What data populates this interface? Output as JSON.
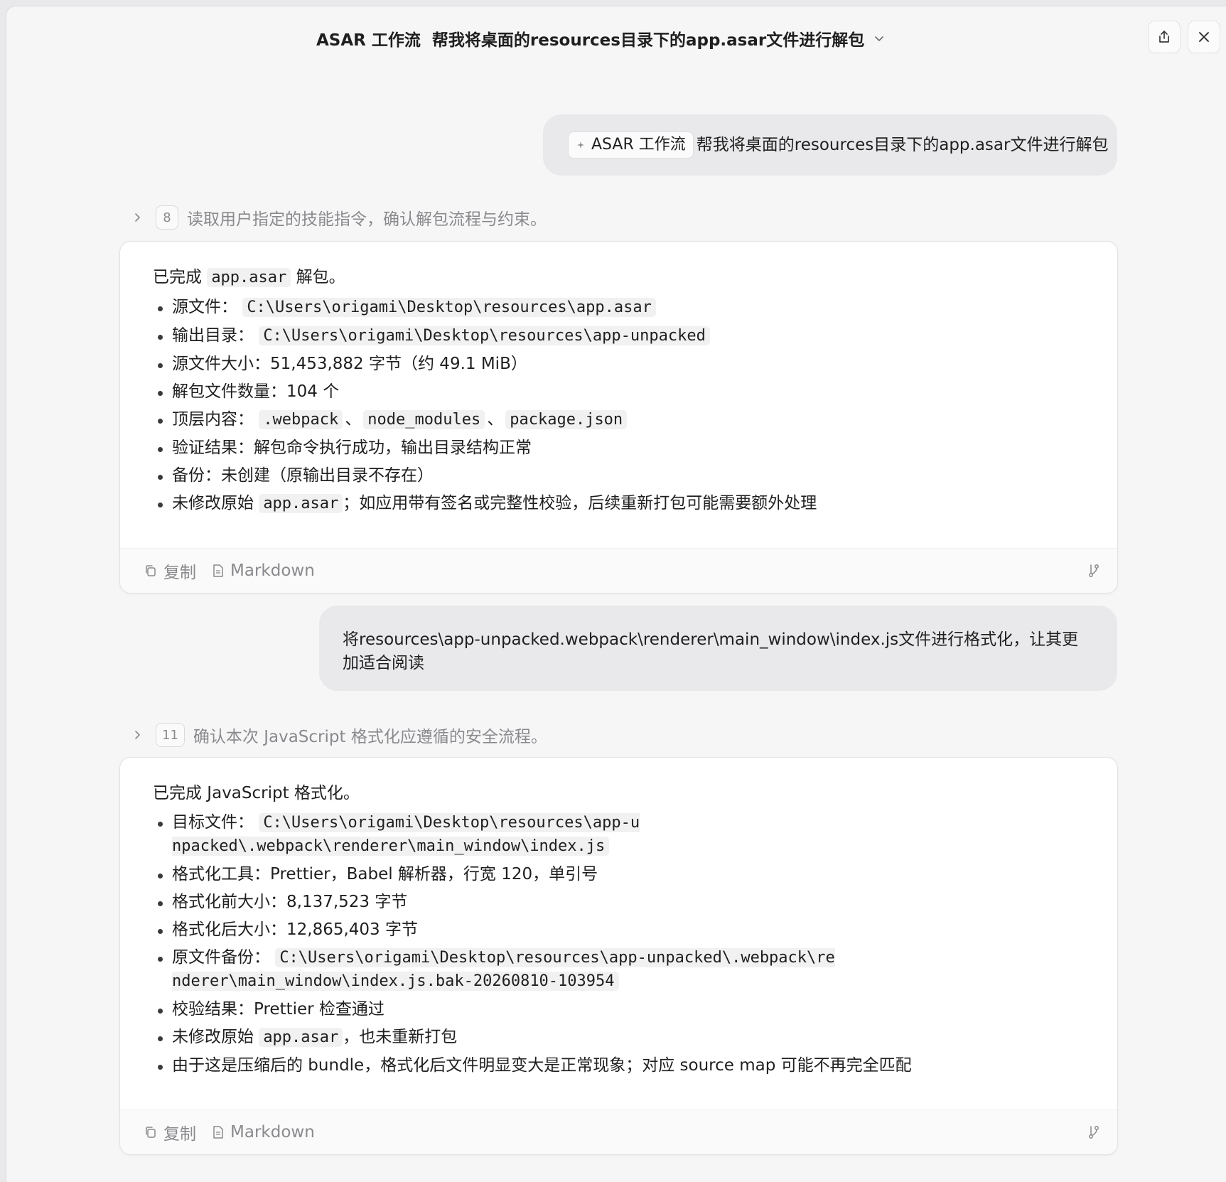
{
  "header": {
    "title": "ASAR 工作流  帮我将桌面的resources目录下的app.asar文件进行解包"
  },
  "messages": {
    "user1": {
      "chip_label": "ASAR 工作流",
      "text": "帮我将桌面的resources目录下的app.asar文件进行解包"
    },
    "step1": {
      "count": "8",
      "text": "读取用户指定的技能指令，确认解包流程与约束。"
    },
    "answer1": {
      "lead_prefix": "已完成",
      "lead_code": "app.asar",
      "lead_suffix": "解包。",
      "items": {
        "i0": {
          "label": "源文件：",
          "code": "C:\\Users\\origami\\Desktop\\resources\\app.asar"
        },
        "i1": {
          "label": "输出目录：",
          "code": "C:\\Users\\origami\\Desktop\\resources\\app-unpacked"
        },
        "i2": {
          "text": "源文件大小：51,453,882 字节（约 49.1 MiB）"
        },
        "i3": {
          "text": "解包文件数量：104 个"
        },
        "i4": {
          "label": "顶层内容：",
          "code_a": ".webpack",
          "sep_a": "、",
          "code_b": "node_modules",
          "sep_b": "、",
          "code_c": "package.json"
        },
        "i5": {
          "text": "验证结果：解包命令执行成功，输出目录结构正常"
        },
        "i6": {
          "text": "备份：未创建（原输出目录不存在）"
        },
        "i7": {
          "label": "未修改原始",
          "code": "app.asar",
          "suffix": "；如应用带有签名或完整性校验，后续重新打包可能需要额外处理"
        }
      },
      "copy_label": "复制",
      "markdown_label": "Markdown"
    },
    "user2": {
      "text": "将resources\\app-unpacked.webpack\\renderer\\main_window\\index.js文件进行格式化，让其更加适合阅读"
    },
    "step2": {
      "count": "11",
      "text": "确认本次 JavaScript 格式化应遵循的安全流程。"
    },
    "answer2": {
      "lead": "已完成 JavaScript 格式化。",
      "items": {
        "i0": {
          "label": "目标文件：",
          "code": "C:\\Users\\origami\\Desktop\\resources\\app-unpacked\\.webpack\\renderer\\main_window\\index.js"
        },
        "i1": {
          "text": "格式化工具：Prettier，Babel 解析器，行宽 120，单引号"
        },
        "i2": {
          "text": "格式化前大小：8,137,523 字节"
        },
        "i3": {
          "text": "格式化后大小：12,865,403 字节"
        },
        "i4": {
          "label": "原文件备份：",
          "code": "C:\\Users\\origami\\Desktop\\resources\\app-unpacked\\.webpack\\renderer\\main_window\\index.js.bak-20260810-103954"
        },
        "i5": {
          "text": "校验结果：Prettier 检查通过"
        },
        "i6": {
          "label": "未修改原始",
          "code": "app.asar",
          "suffix": "，也未重新打包"
        },
        "i7": {
          "text": "由于这是压缩后的 bundle，格式化后文件明显变大是正常现象；对应 source map 可能不再完全匹配"
        }
      },
      "copy_label": "复制",
      "markdown_label": "Markdown"
    }
  },
  "icons": {
    "title_chevron": "chevron-down-icon",
    "share": "share-icon",
    "close": "close-icon",
    "chip": "sparkle-icon",
    "step_arrow": "chevron-right-icon",
    "copy": "copy-icon",
    "markdown": "document-icon",
    "branch": "branch-icon"
  },
  "colors": {
    "window_bg": "#f6f6f7",
    "bubble_bg": "#e9e9eb",
    "card_bg": "#ffffff",
    "muted_text": "#8a8a8e",
    "code_bg": "#f1f1f2"
  }
}
